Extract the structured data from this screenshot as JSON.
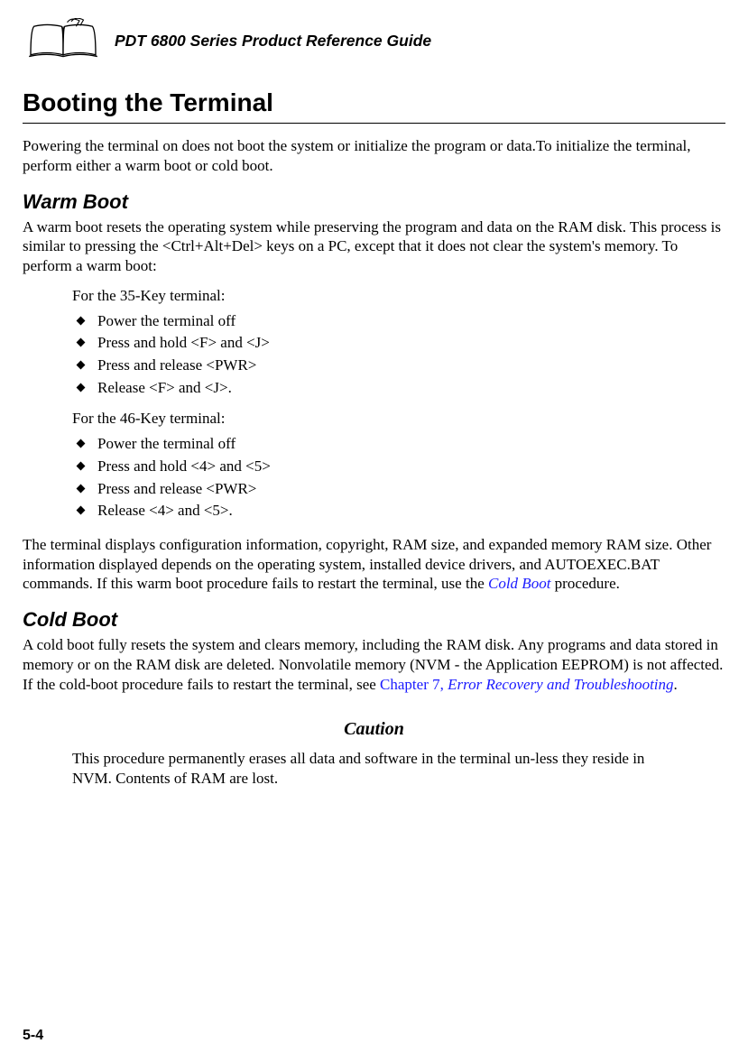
{
  "header": {
    "guide_title": "PDT 6800 Series Product Reference Guide"
  },
  "h1": "Booting the Terminal",
  "intro": "Powering the terminal on does not boot the system or initialize the program or data.To initialize the terminal, perform either a warm boot or cold boot.",
  "warm_boot": {
    "heading": "Warm Boot",
    "para": "A warm boot resets the operating system while preserving the program and data on the RAM disk. This process is similar to pressing the <Ctrl+Alt+Del> keys on a PC, except that it does not clear the system's memory. To perform a warm boot:",
    "proc35_label": "For the 35-Key terminal:",
    "proc35_items": [
      "Power the terminal off",
      "Press and hold <F> and <J>",
      "Press and release <PWR>",
      "Release <F> and <J>."
    ],
    "proc46_label": "For the 46-Key terminal:",
    "proc46_items": [
      "Power the terminal off",
      "Press and hold <4> and <5>",
      "Press and release <PWR>",
      "Release <4> and <5>."
    ],
    "after_pre": "The terminal displays configuration information, copyright, RAM size, and expanded memory RAM size. Other information displayed depends on the operating system, installed device drivers, and AUTOEXEC.BAT commands. If this warm boot procedure fails to restart the terminal, use the ",
    "after_link": "Cold Boot",
    "after_post": " procedure."
  },
  "cold_boot": {
    "heading": "Cold Boot",
    "para_pre": "A cold boot fully resets the system and clears memory, including the RAM disk. Any programs and data stored in memory or on the RAM disk are deleted. Nonvolatile memory (NVM - the Application EEPROM) is not affected. If the cold-boot procedure fails to restart the terminal, see ",
    "para_link_chapter": "Chapter 7, ",
    "para_link_title": "Error Recovery and Troubleshooting",
    "para_post": "."
  },
  "caution": {
    "heading": "Caution",
    "text": "This procedure permanently erases all data and software in the terminal un-less they reside in NVM. Contents of RAM are lost."
  },
  "page_number": "5-4"
}
